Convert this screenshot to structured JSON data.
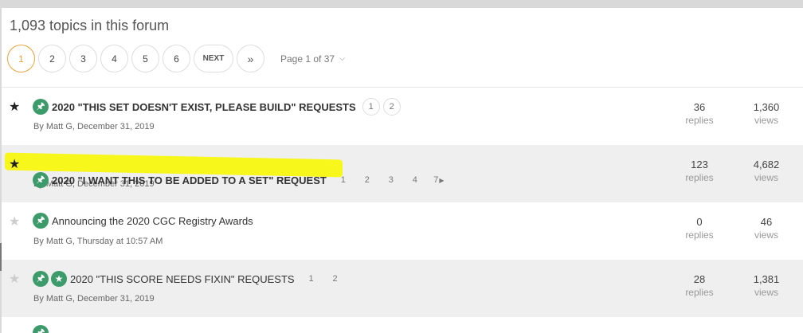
{
  "forum": {
    "topic_count": "1,093 topics in this forum"
  },
  "pagination": {
    "pages": [
      "1",
      "2",
      "3",
      "4",
      "5",
      "6"
    ],
    "active": "1",
    "next_label": "NEXT",
    "last_label": "»",
    "page_info": "Page 1 of 37",
    "dropdown_icon": "chevron-down-icon"
  },
  "topics": [
    {
      "starred": true,
      "badges": [
        "pin-icon"
      ],
      "title": "2020 \"THIS SET DOESN'T EXIST, PLEASE BUILD\" REQUESTS",
      "mini_pages": [
        "1",
        "2"
      ],
      "byline": "By Matt G, December 31, 2019",
      "replies": "36",
      "replies_label": "replies",
      "views": "1,360",
      "views_label": "views"
    },
    {
      "starred": true,
      "highlighted": true,
      "badges": [
        "pin-icon"
      ],
      "title": "2020 \"I WANT THIS TO BE ADDED TO A SET\" REQUEST",
      "mini_pages": [
        "1",
        "2",
        "3",
        "4",
        "7"
      ],
      "byline": "By Matt G, December 31, 2019",
      "replies": "123",
      "replies_label": "replies",
      "views": "4,682",
      "views_label": "views"
    },
    {
      "starred": false,
      "badges": [
        "pin-icon"
      ],
      "title": "Announcing the 2020 CGC Registry Awards",
      "mini_pages": [],
      "byline": "By Matt G, Thursday at 10:57 AM",
      "replies": "0",
      "replies_label": "replies",
      "views": "46",
      "views_label": "views"
    },
    {
      "starred": false,
      "badges": [
        "pin-icon",
        "star-icon"
      ],
      "title": "2020 \"THIS SCORE NEEDS FIXIN\" REQUESTS",
      "mini_pages": [
        "1",
        "2"
      ],
      "byline": "By Matt G, December 31, 2019",
      "replies": "28",
      "replies_label": "replies",
      "views": "1,381",
      "views_label": "views"
    }
  ],
  "colors": {
    "accent": "#e8a33d",
    "badge": "#3c9a6b",
    "highlight": "#f7f71c"
  }
}
